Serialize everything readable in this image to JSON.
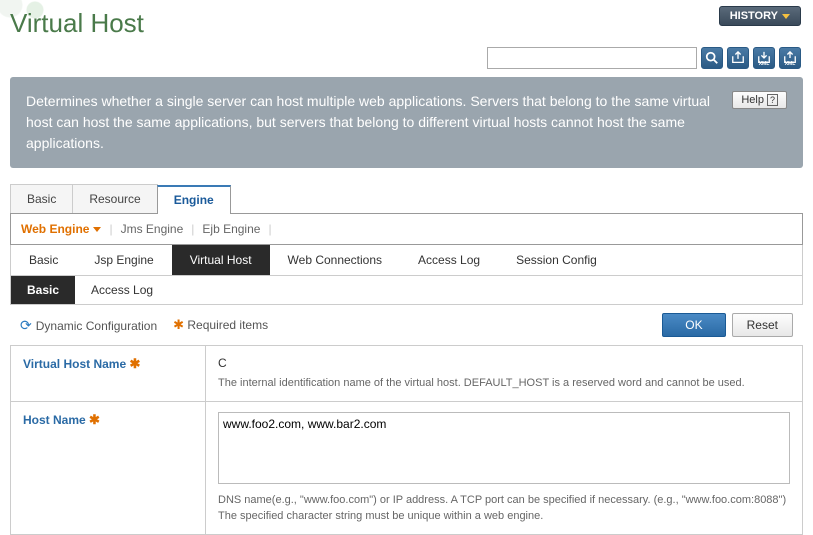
{
  "header": {
    "title": "Virtual Host",
    "history_label": "HISTORY"
  },
  "search": {
    "placeholder": ""
  },
  "banner": {
    "description": "Determines whether a single server can host multiple web applications. Servers that belong to the same virtual host can host the same applications, but servers that belong to different virtual hosts cannot host the same applications.",
    "help_label": "Help"
  },
  "tabs_level1": [
    {
      "label": "Basic",
      "active": false
    },
    {
      "label": "Resource",
      "active": false
    },
    {
      "label": "Engine",
      "active": true
    }
  ],
  "engine_selector": {
    "selected": "Web Engine",
    "others": [
      "Jms Engine",
      "Ejb Engine"
    ]
  },
  "tabs_level2": [
    {
      "label": "Basic",
      "active": false
    },
    {
      "label": "Jsp Engine",
      "active": false
    },
    {
      "label": "Virtual Host",
      "active": true
    },
    {
      "label": "Web Connections",
      "active": false
    },
    {
      "label": "Access Log",
      "active": false
    },
    {
      "label": "Session Config",
      "active": false
    }
  ],
  "tabs_level3": [
    {
      "label": "Basic",
      "active": true
    },
    {
      "label": "Access Log",
      "active": false
    }
  ],
  "legend": {
    "dynamic": "Dynamic Configuration",
    "required": "Required items",
    "ok_label": "OK",
    "reset_label": "Reset"
  },
  "form": {
    "virtual_host_name": {
      "label": "Virtual Host Name",
      "value": "C",
      "hint": "The internal identification name of the virtual host. DEFAULT_HOST is a reserved word and cannot be used."
    },
    "host_name": {
      "label": "Host Name",
      "value": "www.foo2.com, www.bar2.com",
      "hint": "DNS name(e.g., \"www.foo.com\") or IP address. A TCP port can be specified if necessary. (e.g., \"www.foo.com:8088\") The specified character string must be unique within a web engine."
    }
  }
}
